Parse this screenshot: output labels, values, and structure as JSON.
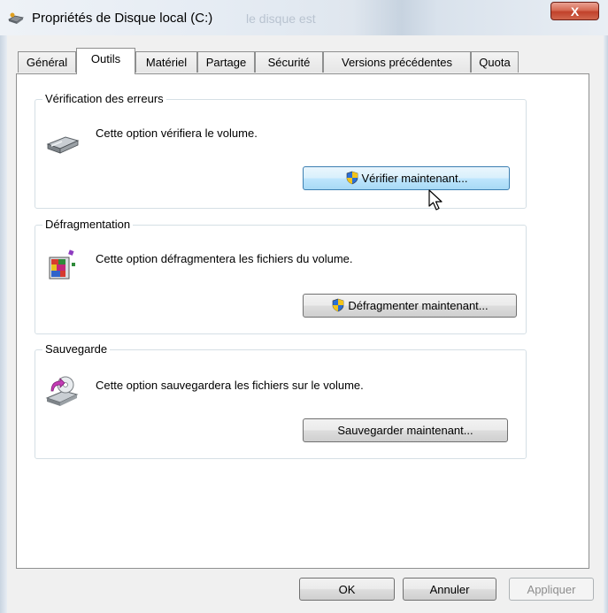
{
  "window": {
    "title": "Propriétés de Disque local (C:)",
    "background_ghost_text": "le disque est",
    "close_glyph": "X"
  },
  "tabs": [
    {
      "label": "Général",
      "active": false
    },
    {
      "label": "Outils",
      "active": true
    },
    {
      "label": "Matériel",
      "active": false
    },
    {
      "label": "Partage",
      "active": false
    },
    {
      "label": "Sécurité",
      "active": false
    },
    {
      "label": "Versions précédentes",
      "active": false
    },
    {
      "label": "Quota",
      "active": false
    }
  ],
  "groups": {
    "error_check": {
      "title": "Vérification des erreurs",
      "description": "Cette option vérifiera le volume.",
      "button_label": "Vérifier maintenant...",
      "icon": "hard-drive-icon"
    },
    "defrag": {
      "title": "Défragmentation",
      "description": "Cette option défragmentera les fichiers du volume.",
      "button_label": "Défragmenter maintenant...",
      "icon": "defrag-icon"
    },
    "backup": {
      "title": "Sauvegarde",
      "description": "Cette option sauvegardera les fichiers sur le volume.",
      "button_label": "Sauvegarder maintenant...",
      "icon": "backup-icon"
    }
  },
  "footer": {
    "ok_label": "OK",
    "cancel_label": "Annuler",
    "apply_label": "Appliquer"
  },
  "colors": {
    "close_button": "#c1412b",
    "hover_button": "#bee6fd",
    "shield_blue": "#2a6fd6",
    "shield_yellow": "#f2c41a"
  }
}
